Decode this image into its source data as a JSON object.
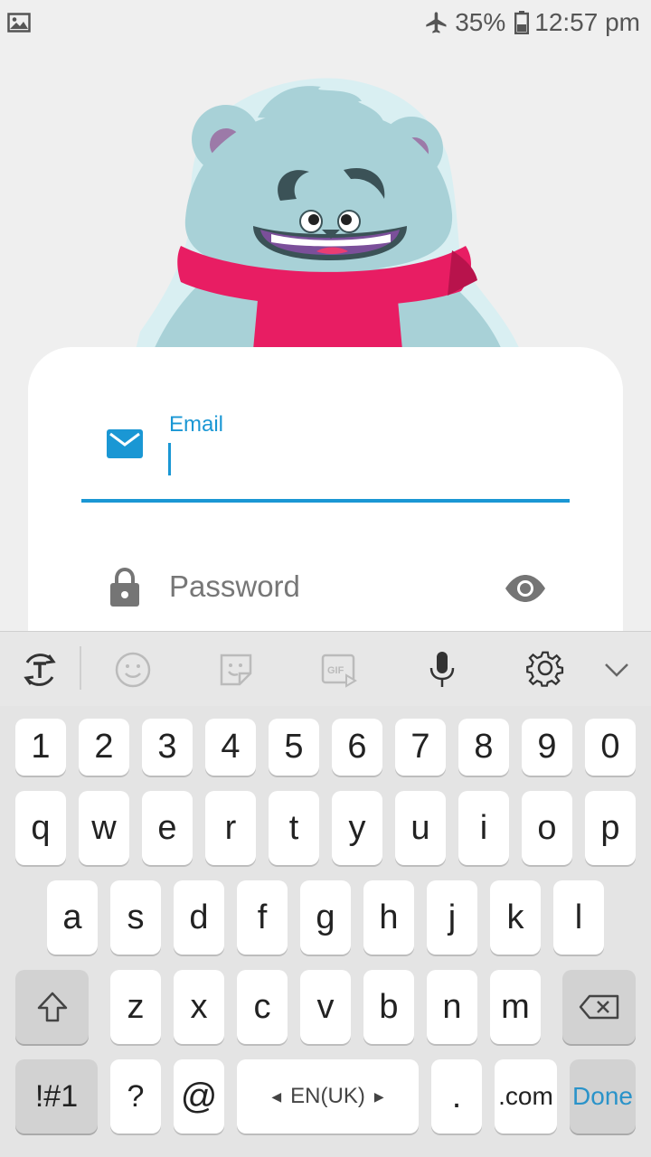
{
  "status_bar": {
    "battery_percent": "35%",
    "time": "12:57 pm",
    "icons": [
      "gallery-icon",
      "airplane-icon",
      "battery-icon"
    ]
  },
  "login_form": {
    "email_label": "Email",
    "email_value": "",
    "password_placeholder": "Password",
    "accent_color": "#1a97d4"
  },
  "keyboard": {
    "toolbar_icons": [
      "text-mode-icon",
      "emoji-icon",
      "sticker-icon",
      "gif-icon",
      "microphone-icon",
      "settings-icon",
      "collapse-chevron-icon"
    ],
    "gif_label": "GIF",
    "row1": [
      "1",
      "2",
      "3",
      "4",
      "5",
      "6",
      "7",
      "8",
      "9",
      "0"
    ],
    "row2": [
      "q",
      "w",
      "e",
      "r",
      "t",
      "y",
      "u",
      "i",
      "o",
      "p"
    ],
    "row3": [
      "a",
      "s",
      "d",
      "f",
      "g",
      "h",
      "j",
      "k",
      "l"
    ],
    "row4": [
      "z",
      "x",
      "c",
      "v",
      "b",
      "n",
      "m"
    ],
    "symbols_label": "!#1",
    "question_label": "?",
    "at_label": "@",
    "space_label": "EN(UK)",
    "period_label": ".",
    "com_label": ".com",
    "done_label": "Done"
  }
}
